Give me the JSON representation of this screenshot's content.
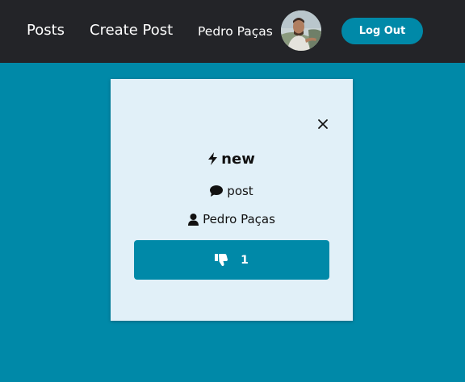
{
  "nav": {
    "links": [
      "Posts",
      "Create Post"
    ],
    "username": "Pedro Paças",
    "logout_label": "Log Out"
  },
  "post": {
    "title": "new",
    "type": "post",
    "author": "Pedro Paças",
    "votes": "1"
  },
  "colors": {
    "navbar": "#232428",
    "accent": "#0089a8",
    "card": "#e1f0f8"
  },
  "icons": [
    "lightning-bolt-icon",
    "speech-bubble-icon",
    "user-icon",
    "thumbs-down-icon",
    "close-icon"
  ]
}
